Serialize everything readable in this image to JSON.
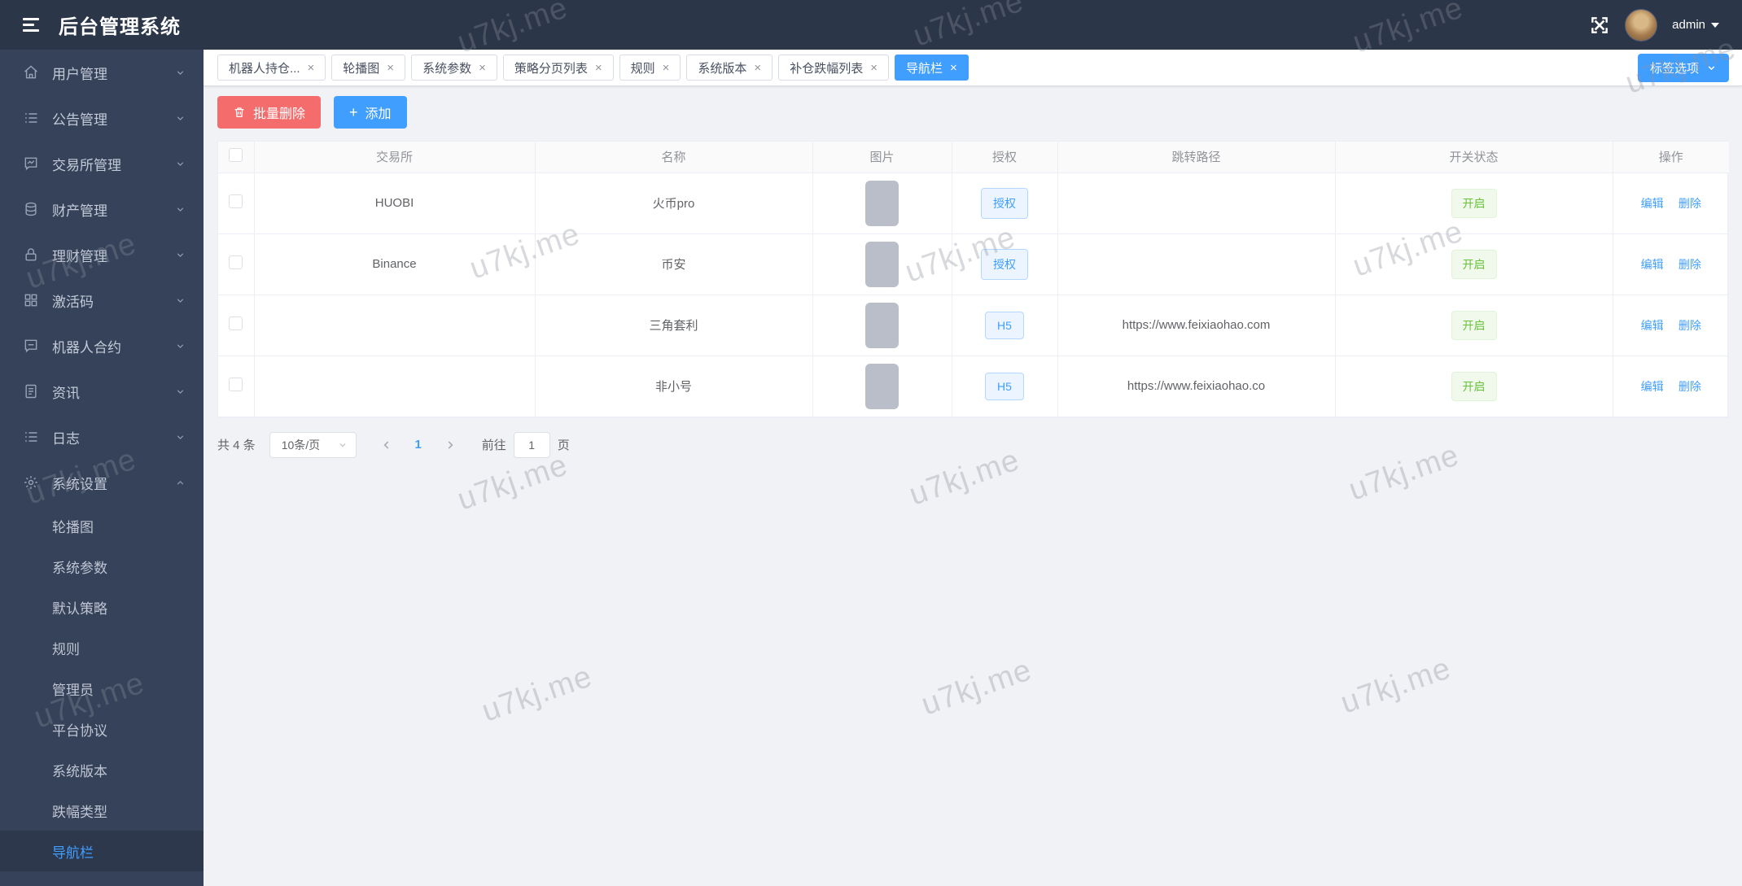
{
  "header": {
    "title": "后台管理系统",
    "username": "admin"
  },
  "tabs": [
    {
      "label": "机器人持仓..."
    },
    {
      "label": "轮播图"
    },
    {
      "label": "系统参数"
    },
    {
      "label": "策略分页列表"
    },
    {
      "label": "规则"
    },
    {
      "label": "系统版本"
    },
    {
      "label": "补仓跌幅列表"
    },
    {
      "label": "导航栏"
    }
  ],
  "tab_options_label": "标签选项",
  "sidebar": {
    "items": [
      {
        "label": "用户管理"
      },
      {
        "label": "公告管理"
      },
      {
        "label": "交易所管理"
      },
      {
        "label": "财产管理"
      },
      {
        "label": "理财管理"
      },
      {
        "label": "激活码"
      },
      {
        "label": "机器人合约"
      },
      {
        "label": "资讯"
      },
      {
        "label": "日志"
      },
      {
        "label": "系统设置"
      }
    ],
    "subitems": [
      {
        "label": "轮播图"
      },
      {
        "label": "系统参数"
      },
      {
        "label": "默认策略"
      },
      {
        "label": "规则"
      },
      {
        "label": "管理员"
      },
      {
        "label": "平台协议"
      },
      {
        "label": "系统版本"
      },
      {
        "label": "跌幅类型"
      },
      {
        "label": "导航栏"
      }
    ]
  },
  "toolbar": {
    "batch_delete_label": "批量删除",
    "add_label": "添加"
  },
  "table": {
    "columns": [
      "交易所",
      "名称",
      "图片",
      "授权",
      "跳转路径",
      "开关状态",
      "操作"
    ],
    "rows": [
      {
        "exchange": "HUOBI",
        "name": "火币pro",
        "auth": "授权",
        "path": "",
        "status": "开启"
      },
      {
        "exchange": "Binance",
        "name": "币安",
        "auth": "授权",
        "path": "",
        "status": "开启"
      },
      {
        "exchange": "",
        "name": "三角套利",
        "auth": "H5",
        "path": "https://www.feixiaohao.com",
        "status": "开启"
      },
      {
        "exchange": "",
        "name": "非小号",
        "auth": "H5",
        "path": "https://www.feixiaohao.co",
        "status": "开启"
      }
    ],
    "actions": {
      "edit": "编辑",
      "delete": "删除"
    }
  },
  "pagination": {
    "total": "共 4 条",
    "page_size": "10条/页",
    "current_page": "1",
    "goto_label": "前往",
    "goto_value": "1",
    "page_unit": "页"
  },
  "watermark": {
    "text": "u7kj.me"
  },
  "colors": {
    "accent": "#409eff",
    "danger": "#f56c6c",
    "success": "#67c23a",
    "header_bg": "#2b3648",
    "sidebar_bg": "#35425a"
  }
}
